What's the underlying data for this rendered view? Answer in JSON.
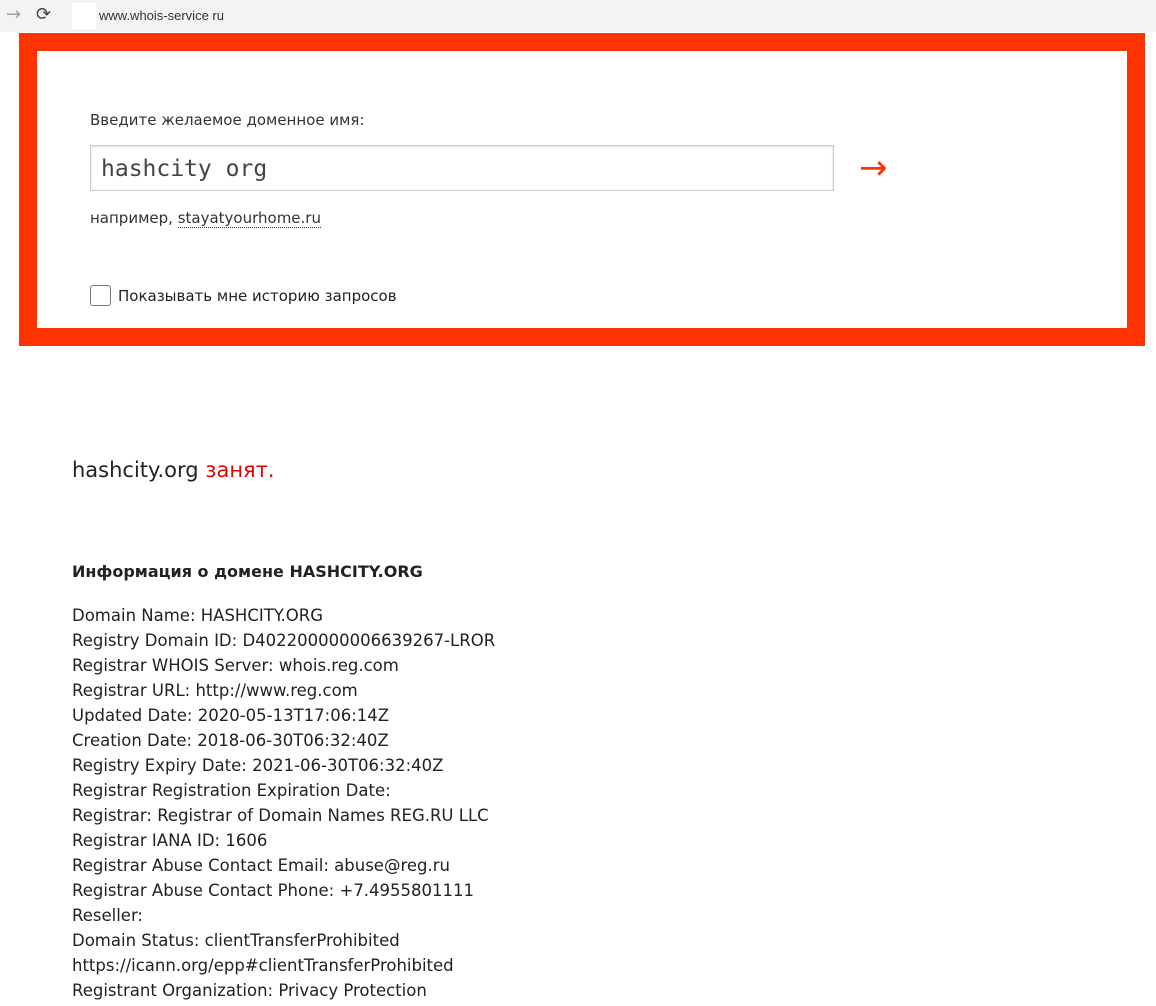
{
  "browser": {
    "url": "www.whois-service ru",
    "forward_icon": "arrow-right",
    "reload_icon": "reload"
  },
  "form": {
    "label": "Введите желаемое доменное имя:",
    "input_value": "hashcity org",
    "submit_icon": "→",
    "example_prefix": "например,",
    "example_link": "stayatyourhome.ru",
    "history_checkbox_label": "Показывать мне историю запросов",
    "history_checked": false,
    "accent_color": "#ff3300"
  },
  "result": {
    "domain": "hashcity.org",
    "status": "занят."
  },
  "info": {
    "heading": "Информация о домене HASHCITY.ORG",
    "lines": [
      "Domain Name: HASHCITY.ORG",
      "Registry Domain ID: D402200000006639267-LROR",
      "Registrar WHOIS Server: whois.reg.com",
      "Registrar URL: http://www.reg.com",
      "Updated Date: 2020-05-13T17:06:14Z",
      "Creation Date: 2018-06-30T06:32:40Z",
      "Registry Expiry Date: 2021-06-30T06:32:40Z",
      "Registrar Registration Expiration Date:",
      "Registrar: Registrar of Domain Names REG.RU LLC",
      "Registrar IANA ID: 1606",
      "Registrar Abuse Contact Email: abuse@reg.ru",
      "Registrar Abuse Contact Phone: +7.4955801111",
      "Reseller:",
      "Domain Status: clientTransferProhibited",
      "https://icann.org/epp#clientTransferProhibited",
      "Registrant Organization: Privacy Protection"
    ]
  }
}
